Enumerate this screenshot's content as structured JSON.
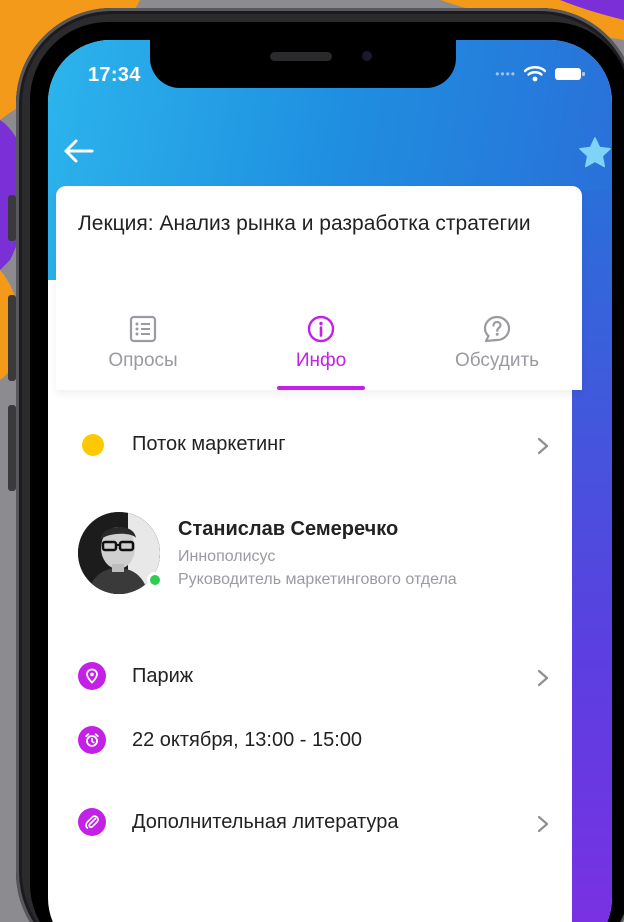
{
  "status_bar": {
    "time": "17:34"
  },
  "header": {
    "back_icon": "arrow-left-icon",
    "favorite_icon": "star-icon"
  },
  "lecture": {
    "title": "Лекция: Анализ рынка и разработка стратегии"
  },
  "tabs": [
    {
      "label": "Опросы",
      "icon": "list-icon",
      "active": false
    },
    {
      "label": "Инфо",
      "icon": "info-icon",
      "active": true
    },
    {
      "label": "Обсудить",
      "icon": "question-bubble-icon",
      "active": false
    }
  ],
  "stream": {
    "label": "Поток маркетинг",
    "color": "#ffc800"
  },
  "speaker": {
    "name": "Станислав Семеречко",
    "organization": "Иннополисус",
    "position": "Руководитель маркетингового отдела",
    "online": true
  },
  "details": {
    "location": "Париж",
    "datetime": "22 октября, 13:00 - 15:00",
    "literature": "Дополнительная литература"
  },
  "colors": {
    "accent": "#c322e6",
    "header_start": "#2cb4ec",
    "header_end": "#2a6fd9",
    "online": "#2ecc52"
  }
}
